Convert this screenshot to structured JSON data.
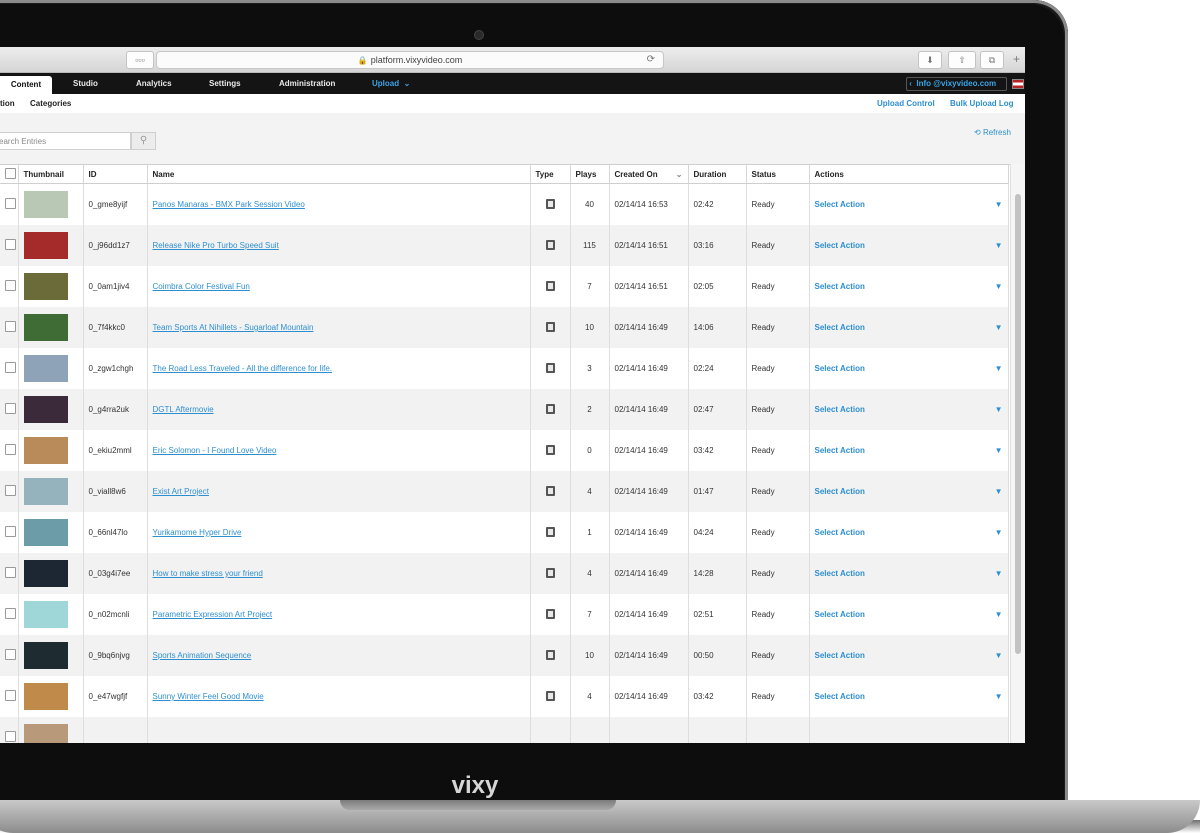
{
  "browser": {
    "url": "platform.vixyvideo.com",
    "reload_icon": "reload-icon"
  },
  "nav": {
    "items": [
      "Content",
      "Studio",
      "Analytics",
      "Settings",
      "Administration",
      "Upload"
    ],
    "account": "Info @vixyvideo.com"
  },
  "subnav": {
    "left": [
      "tion",
      "Categories"
    ],
    "right": [
      "Upload Control",
      "Bulk Upload Log"
    ]
  },
  "toolbar": {
    "search_placeholder": "earch Entries",
    "refresh": "Refresh"
  },
  "table": {
    "headers": [
      "Thumbnail",
      "ID",
      "Name",
      "Type",
      "Plays",
      "Created On",
      "Duration",
      "Status",
      "Actions"
    ],
    "rows": [
      {
        "id": "0_gme8yijf",
        "name": "Panos Manaras - BMX Park Session Video",
        "plays": "40",
        "created": "02/14/14 16:53",
        "duration": "02:42",
        "status": "Ready",
        "action": "Select Action",
        "thumb_color": "#b9c7b5"
      },
      {
        "id": "0_j96dd1z7",
        "name": "Release Nike Pro Turbo Speed Suit",
        "plays": "115",
        "created": "02/14/14 16:51",
        "duration": "03:16",
        "status": "Ready",
        "action": "Select Action",
        "thumb_color": "#a52a2a"
      },
      {
        "id": "0_0am1jiv4",
        "name": "Coimbra Color Festival Fun",
        "plays": "7",
        "created": "02/14/14 16:51",
        "duration": "02:05",
        "status": "Ready",
        "action": "Select Action",
        "thumb_color": "#6b6b3a"
      },
      {
        "id": "0_7f4kkc0",
        "name": "Team Sports At Nihillets - Sugarloaf Mountain",
        "plays": "10",
        "created": "02/14/14 16:49",
        "duration": "14:06",
        "status": "Ready",
        "action": "Select Action",
        "thumb_color": "#3f6b34"
      },
      {
        "id": "0_zgw1chgh",
        "name": "The Road Less Traveled - All the difference for life.",
        "plays": "3",
        "created": "02/14/14 16:49",
        "duration": "02:24",
        "status": "Ready",
        "action": "Select Action",
        "thumb_color": "#8fa3b8"
      },
      {
        "id": "0_g4rra2uk",
        "name": "DGTL Aftermovie",
        "plays": "2",
        "created": "02/14/14 16:49",
        "duration": "02:47",
        "status": "Ready",
        "action": "Select Action",
        "thumb_color": "#3a2a3a"
      },
      {
        "id": "0_ekiu2mml",
        "name": "Eric Solomon - I Found Love Video",
        "plays": "0",
        "created": "02/14/14 16:49",
        "duration": "03:42",
        "status": "Ready",
        "action": "Select Action",
        "thumb_color": "#b98a5a"
      },
      {
        "id": "0_viall8w6",
        "name": "Exist Art Project",
        "plays": "4",
        "created": "02/14/14 16:49",
        "duration": "01:47",
        "status": "Ready",
        "action": "Select Action",
        "thumb_color": "#95b3bd"
      },
      {
        "id": "0_66nl47lo",
        "name": "Yurikamome Hyper Drive",
        "plays": "1",
        "created": "02/14/14 16:49",
        "duration": "04:24",
        "status": "Ready",
        "action": "Select Action",
        "thumb_color": "#6b9ca8"
      },
      {
        "id": "0_03g4i7ee",
        "name": "How to make stress your friend",
        "plays": "4",
        "created": "02/14/14 16:49",
        "duration": "14:28",
        "status": "Ready",
        "action": "Select Action",
        "thumb_color": "#1d2733"
      },
      {
        "id": "0_n02mcnli",
        "name": "Parametric Expression Art Project",
        "plays": "7",
        "created": "02/14/14 16:49",
        "duration": "02:51",
        "status": "Ready",
        "action": "Select Action",
        "thumb_color": "#9fd6d8"
      },
      {
        "id": "0_9bq6njvg",
        "name": "Sports Animation Sequence",
        "plays": "10",
        "created": "02/14/14 16:49",
        "duration": "00:50",
        "status": "Ready",
        "action": "Select Action",
        "thumb_color": "#1e2b30"
      },
      {
        "id": "0_e47wgfjf",
        "name": "Sunny Winter Feel Good Movie",
        "plays": "4",
        "created": "02/14/14 16:49",
        "duration": "03:42",
        "status": "Ready",
        "action": "Select Action",
        "thumb_color": "#c08a4a"
      },
      {
        "id": "",
        "name": "",
        "plays": "",
        "created": "",
        "duration": "",
        "status": "",
        "action": "",
        "thumb_color": "#b89a7a"
      }
    ]
  },
  "laptop": {
    "brand": "vixy"
  },
  "colors": {
    "accent": "#2c8fd1",
    "nav_bg": "#141414"
  }
}
